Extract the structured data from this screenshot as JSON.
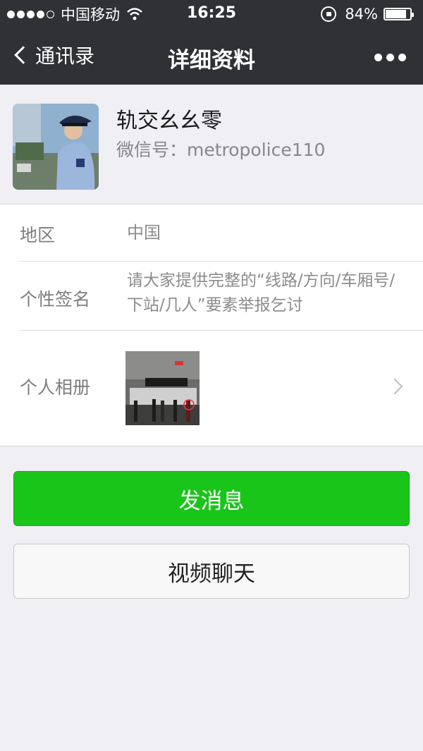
{
  "status_bar": {
    "carrier": "中国移动",
    "time": "16:25",
    "battery_percent": "84%",
    "battery_level": 0.84,
    "signal_bars_filled": 4,
    "signal_bars_total": 5
  },
  "nav": {
    "back_label": "通讯录",
    "title": "详细资料",
    "more_icon": "more-dots-icon"
  },
  "profile": {
    "name": "轨交幺幺零",
    "wechat_id": "微信号：metropolice110"
  },
  "info": {
    "region_label": "地区",
    "region_value": "中国",
    "signature_label": "个性签名",
    "signature_value": "请大家提供完整的“线路/方向/车厢号/下站/几人”要素举报乞讨",
    "album_label": "个人相册"
  },
  "actions": {
    "send_message": "发消息",
    "video_chat": "视频聊天"
  },
  "colors": {
    "nav_background": "#303134",
    "primary_green": "#1ac51a",
    "page_background": "#efeff4"
  }
}
